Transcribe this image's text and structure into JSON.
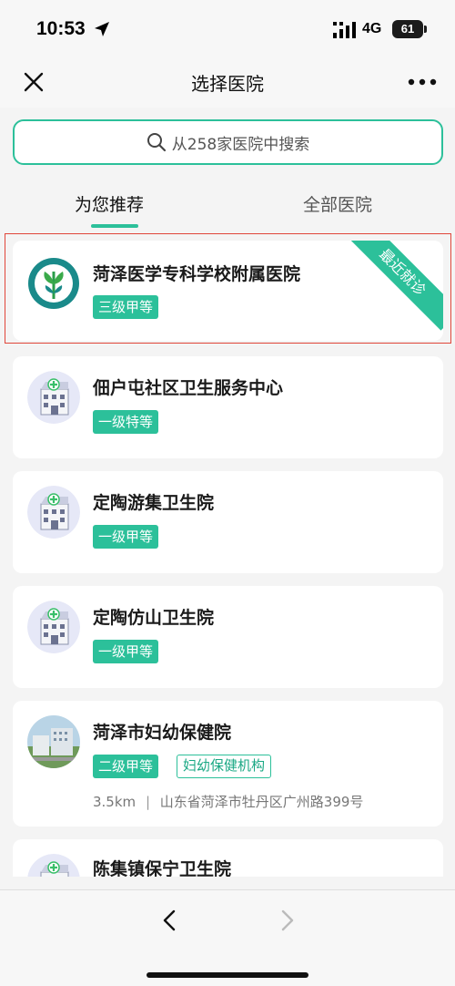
{
  "status_bar": {
    "time": "10:53",
    "network": "4G",
    "battery": "61"
  },
  "nav": {
    "title": "选择医院"
  },
  "search": {
    "placeholder": "从258家医院中搜索"
  },
  "tabs": [
    {
      "label": "为您推荐",
      "active": true
    },
    {
      "label": "全部医院",
      "active": false
    }
  ],
  "hospitals": [
    {
      "name": "菏泽医学专科学校附属医院",
      "tags": [
        "三级甲等"
      ],
      "ribbon": "最近就诊",
      "logo": "school-emblem-icon"
    },
    {
      "name": "佃户屯社区卫生服务中心",
      "tags": [
        "一级特等"
      ],
      "logo": "hospital-building-icon"
    },
    {
      "name": "定陶游集卫生院",
      "tags": [
        "一级甲等"
      ],
      "logo": "hospital-building-icon"
    },
    {
      "name": "定陶仿山卫生院",
      "tags": [
        "一级甲等"
      ],
      "logo": "hospital-building-icon"
    },
    {
      "name": "菏泽市妇幼保健院",
      "tags": [
        "二级甲等",
        "妇幼保健机构"
      ],
      "distance": "3.5km",
      "address": "山东省菏泽市牡丹区广州路399号",
      "logo": "hospital-photo-icon"
    },
    {
      "name": "陈集镇保宁卫生院",
      "tags": [],
      "logo": "hospital-building-icon"
    }
  ],
  "colors": {
    "accent": "#2cc09a",
    "highlight": "#e0463a"
  }
}
